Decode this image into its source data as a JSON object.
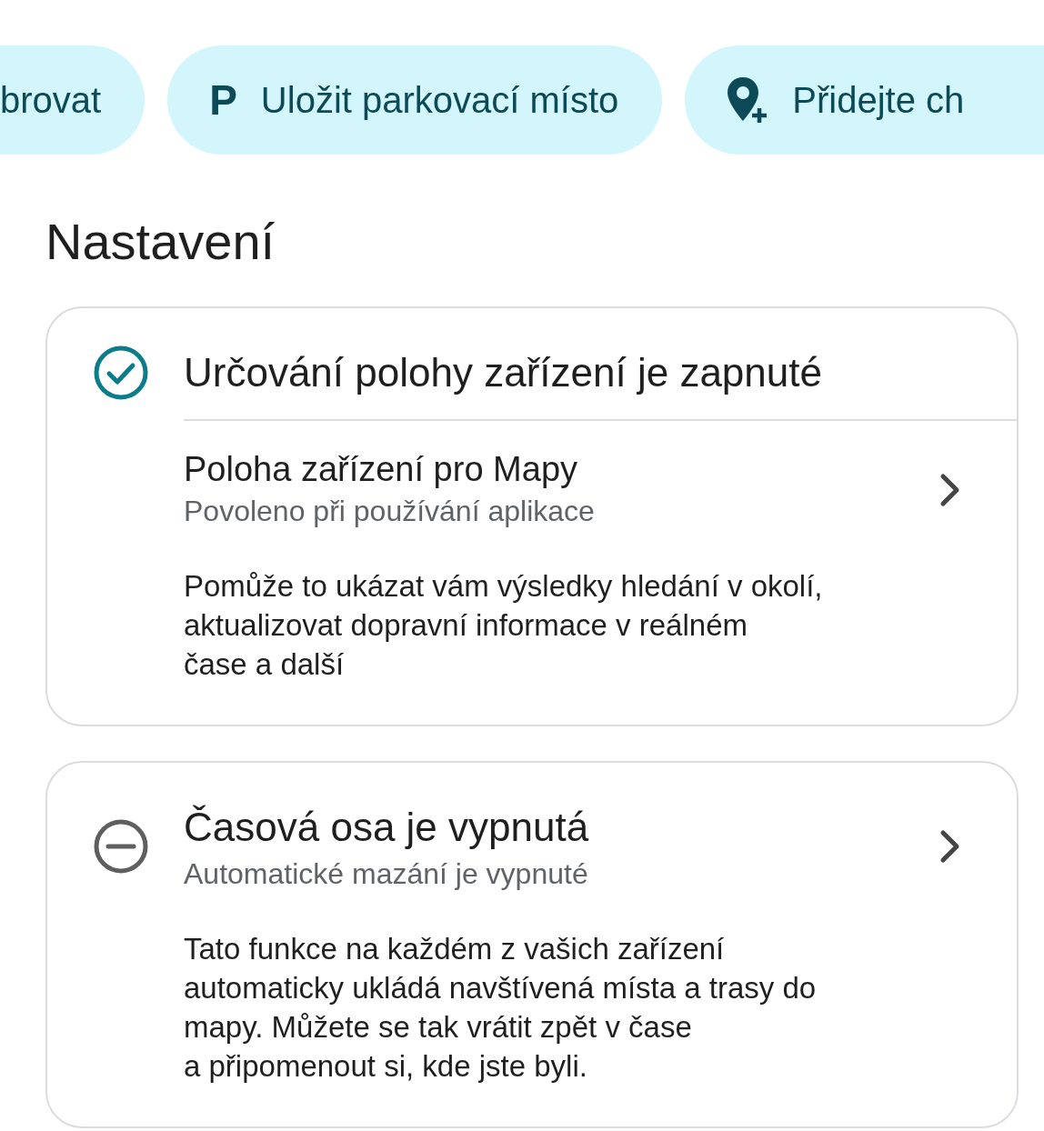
{
  "chips": [
    {
      "kind": "plain",
      "label": "brovat"
    },
    {
      "kind": "parking",
      "icon_text": "P",
      "label": "Uložit parkovací místo"
    },
    {
      "kind": "add_place",
      "label": "Přidejte ch"
    }
  ],
  "settings": {
    "title": "Nastavení",
    "cards": [
      {
        "kind": "divided",
        "on": true,
        "title": "Určování polohy zařízení je zapnuté",
        "row_title": "Poloha zařízení pro Mapy",
        "row_subtitle": "Povoleno při používání aplikace",
        "description": "Pomůže to ukázat vám výsledky hledání v okolí,\naktualizovat dopravní informace v reálném\nčase a další"
      },
      {
        "kind": "inline",
        "on": false,
        "title": "Časová osa je vypnutá",
        "row_subtitle": "Automatické mazání je vypnuté",
        "description": "Tato funkce na každém z vašich zařízení\nautomaticky ukládá navštívená místa a trasy do\nmapy. Můžete se tak vrátit zpět v čase\na připomenout si, kde jste byli."
      }
    ]
  }
}
